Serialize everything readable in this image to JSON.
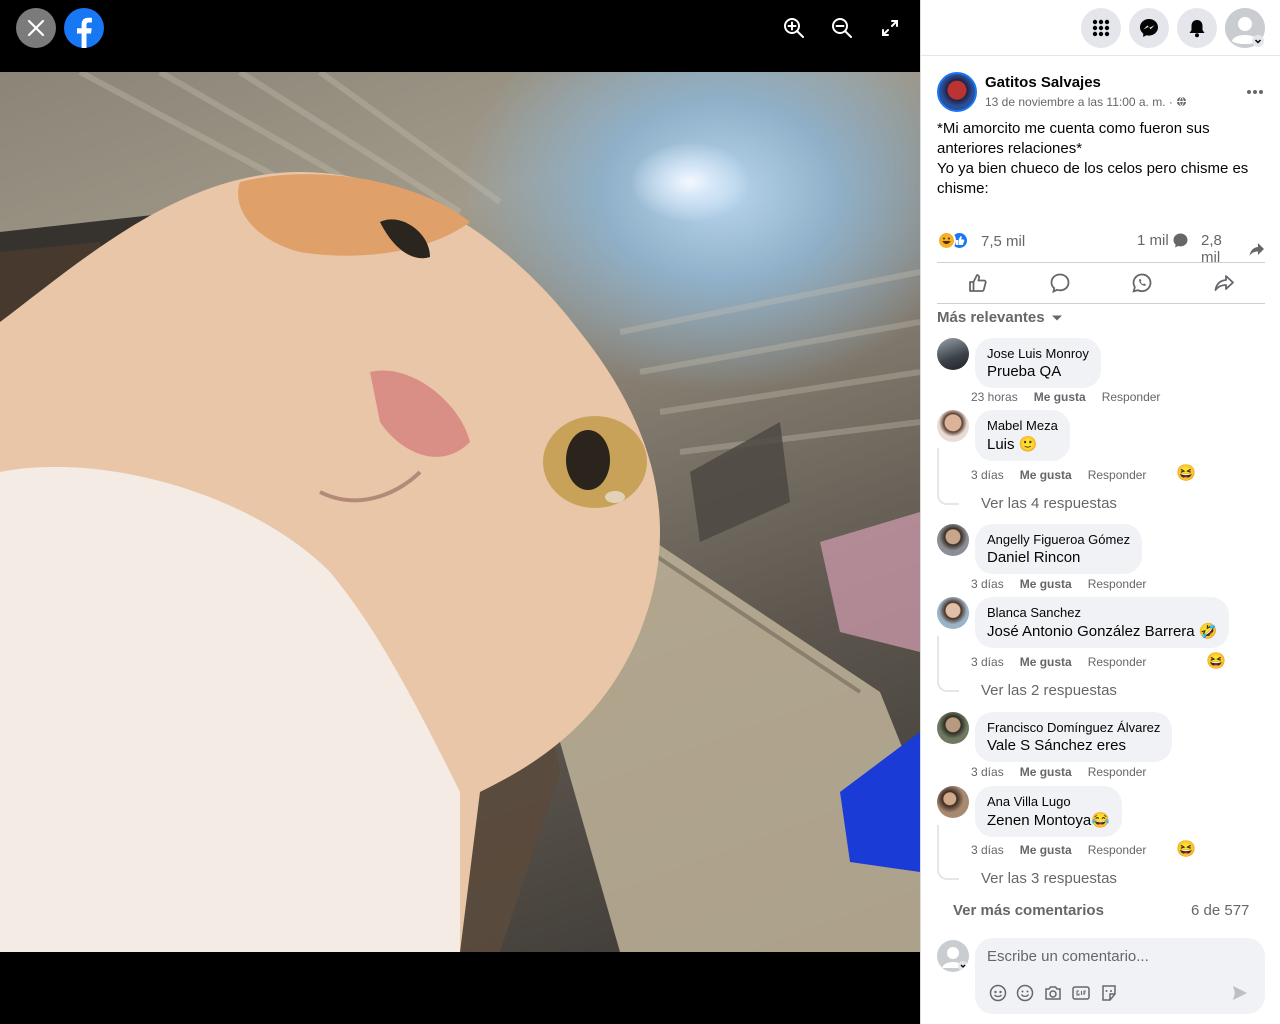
{
  "colors": {
    "brand": "#1877f2",
    "text": "#050505",
    "muted": "#65676b",
    "bubble": "#f0f2f5"
  },
  "viewer": {
    "icons": [
      "close-icon",
      "facebook-logo",
      "zoom-in-icon",
      "zoom-out-icon",
      "fullscreen-icon"
    ]
  },
  "topbar": {
    "icons": [
      "menu-grid-icon",
      "messenger-icon",
      "notifications-bell-icon",
      "account-avatar"
    ]
  },
  "post": {
    "page_name": "Gatitos Salvajes",
    "timestamp": "13 de noviembre a las 11:00 a. m. ·",
    "text_line1": "*Mi amorcito me cuenta como fueron sus anteriores relaciones*",
    "text_line2": "Yo ya bien chueco de los celos pero chisme es chisme:",
    "reactions_count": "7,5 mil",
    "comments_count": "1 mil",
    "shares_count": "2,8 mil"
  },
  "sort_label": "Más relevantes",
  "comments": [
    {
      "author": "Jose Luis Monroy",
      "text": "Prueba QA",
      "time": "23 horas",
      "like": "Me gusta",
      "reply": "Responder"
    },
    {
      "author": "Mabel Meza",
      "text": "Luis 🙂",
      "time": "3 días",
      "like": "Me gusta",
      "reply": "Responder",
      "replies": "Ver las 4 respuestas"
    },
    {
      "author": "Angelly Figueroa Gómez",
      "text": "Daniel Rincon",
      "time": "3 días",
      "like": "Me gusta",
      "reply": "Responder"
    },
    {
      "author": "Blanca Sanchez",
      "text": "José Antonio González Barrera 🤣",
      "time": "3 días",
      "like": "Me gusta",
      "reply": "Responder",
      "replies": "Ver las 2 respuestas"
    },
    {
      "author": "Francisco Domínguez Álvarez",
      "text": "Vale S Sánchez eres",
      "time": "3 días",
      "like": "Me gusta",
      "reply": "Responder"
    },
    {
      "author": "Ana Villa Lugo",
      "text": "Zenen Montoya😂",
      "time": "3 días",
      "like": "Me gusta",
      "reply": "Responder",
      "replies": "Ver las 3 respuestas"
    }
  ],
  "more_comments": "Ver más comentarios",
  "comment_pages": "6 de 577",
  "composer": {
    "placeholder": "Escribe un comentario..."
  }
}
